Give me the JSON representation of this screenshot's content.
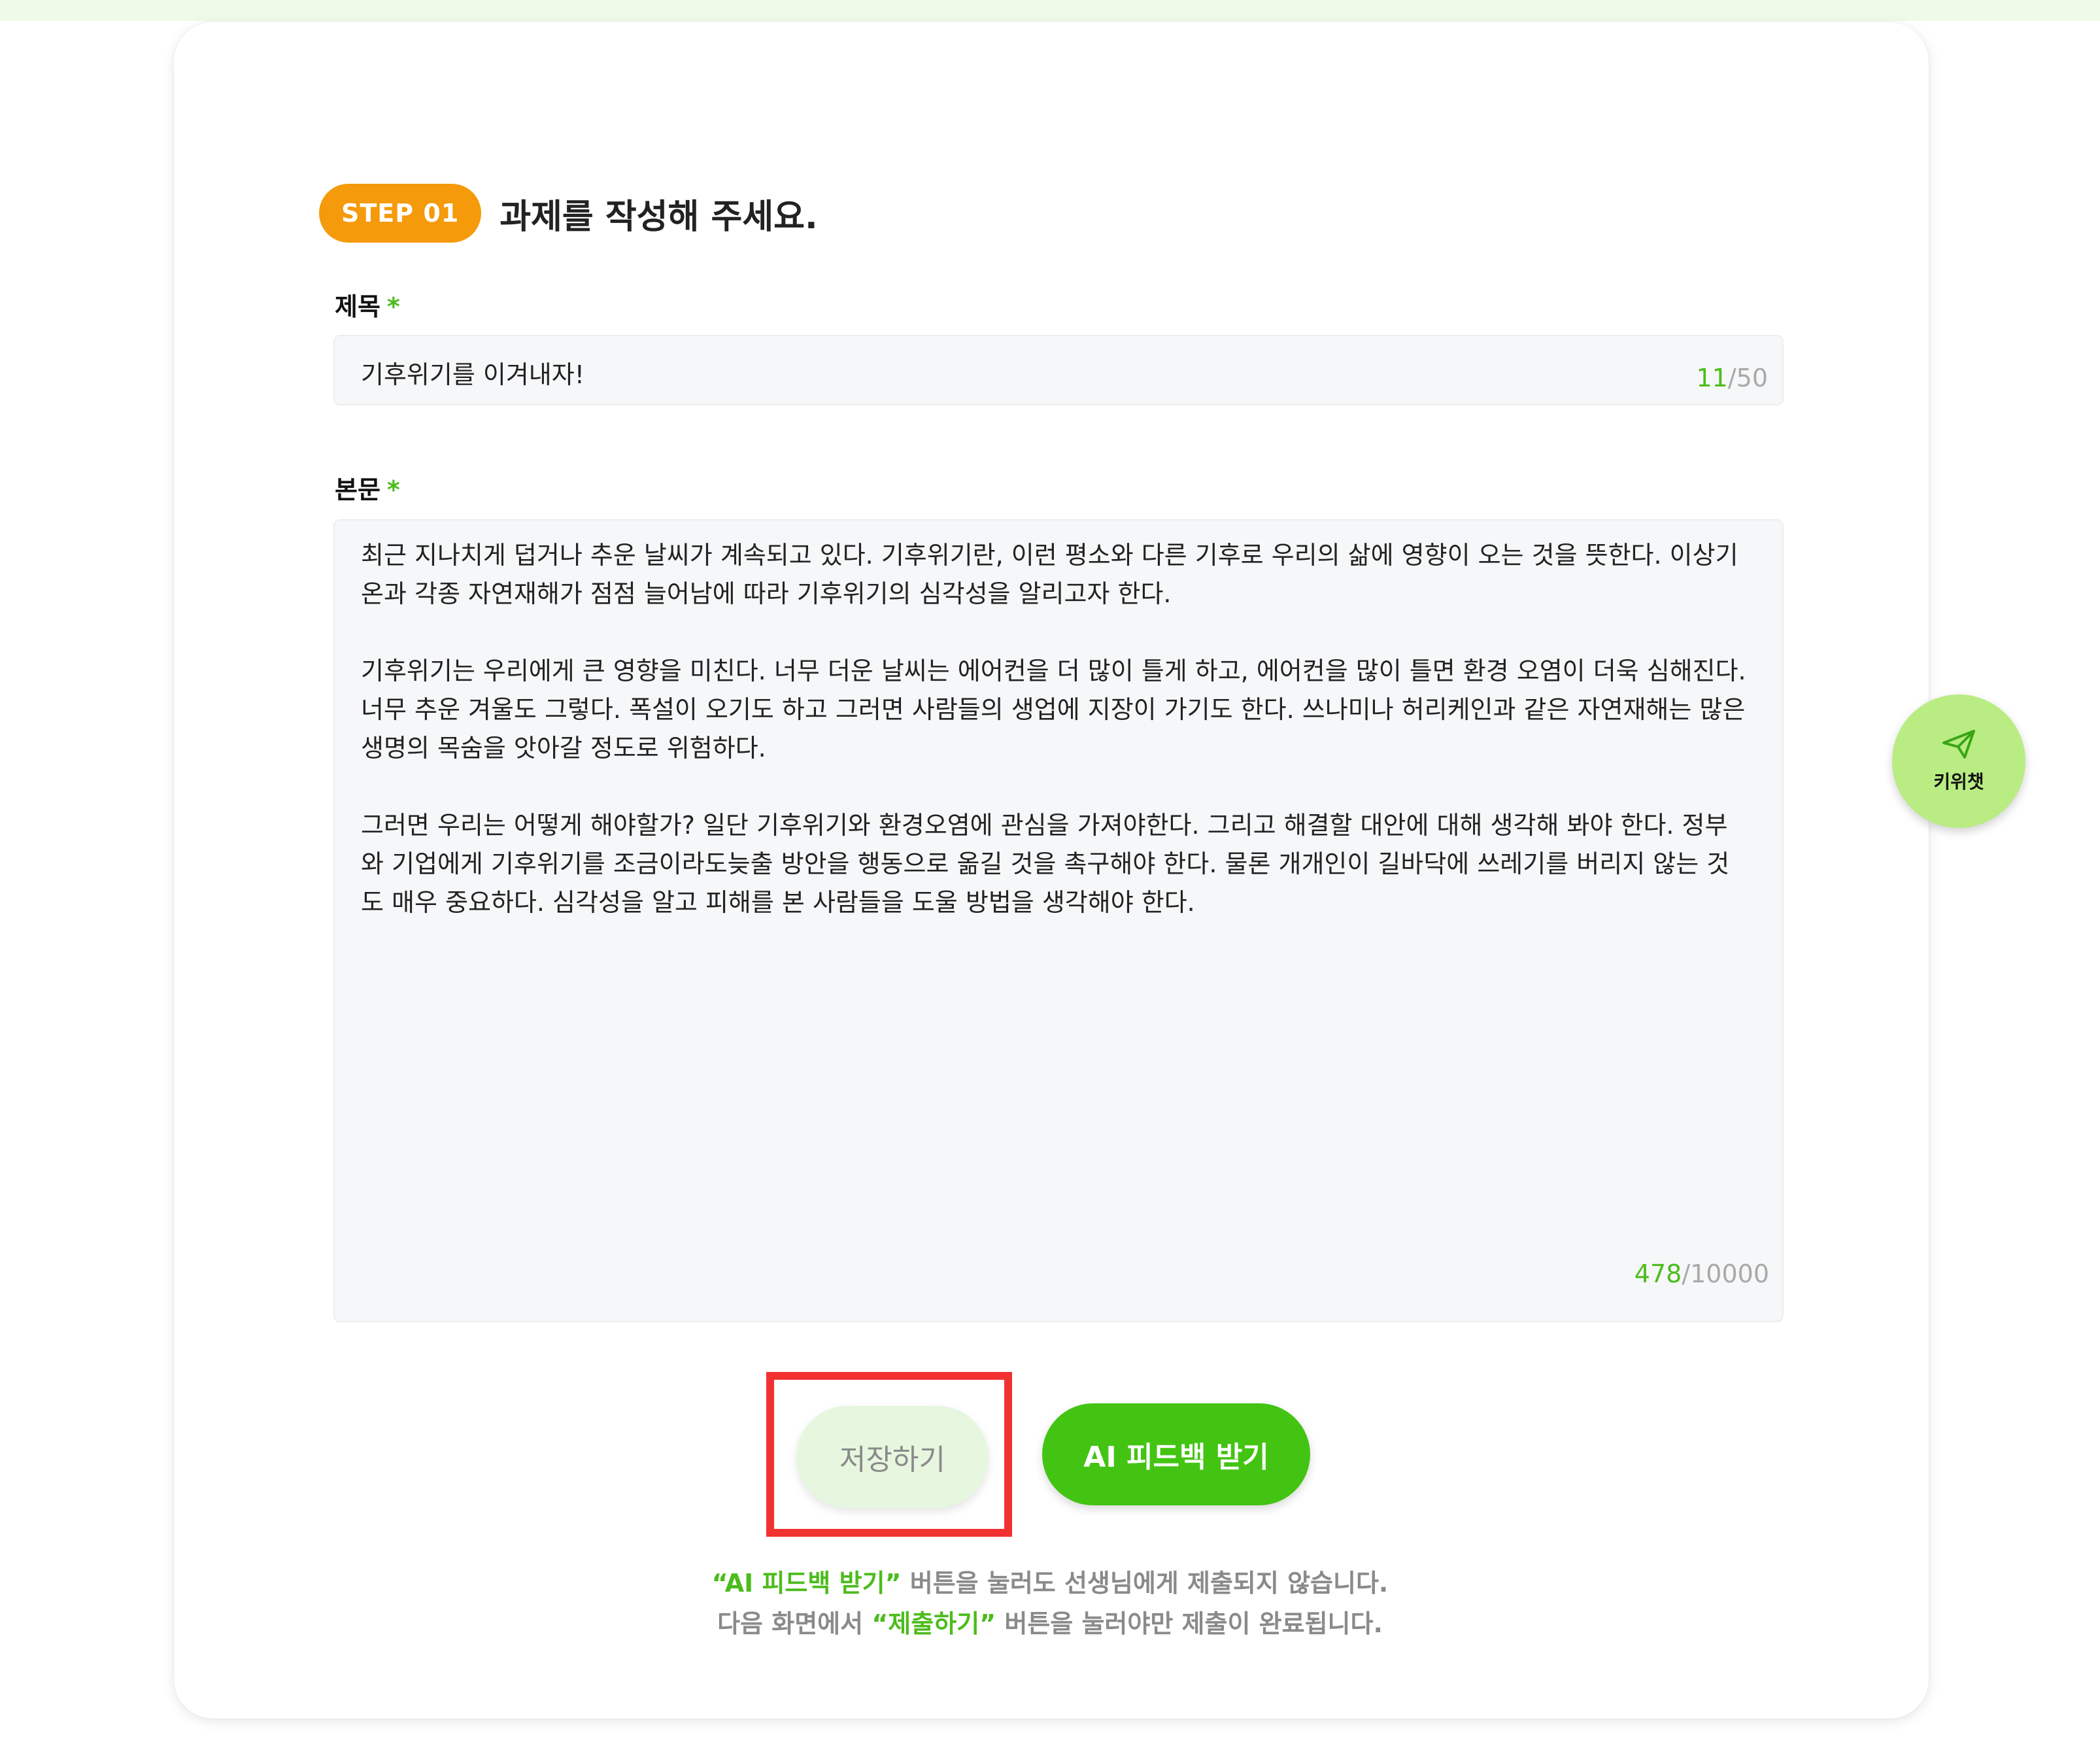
{
  "step": {
    "badge": "STEP 01",
    "title": "과제를 작성해 주세요."
  },
  "title_field": {
    "label": "제목",
    "required_mark": "*",
    "value": "기후위기를 이겨내자!",
    "count_current": "11",
    "count_sep_max": "/50"
  },
  "body_field": {
    "label": "본문",
    "required_mark": "*",
    "paragraphs": [
      "최근 지나치게 덥거나 추운 날씨가 계속되고 있다. 기후위기란, 이런 평소와 다른 기후로 우리의 삶에 영향이 오는 것을 뜻한다. 이상기온과 각종 자연재해가 점점 늘어남에 따라 기후위기의 심각성을 알리고자 한다.",
      "기후위기는 우리에게 큰 영향을 미친다. 너무 더운 날씨는 에어컨을 더 많이 틀게 하고, 에어컨을 많이 틀면 환경 오염이 더욱 심해진다. 너무 추운 겨울도 그렇다. 폭설이 오기도 하고 그러면 사람들의 생업에 지장이 가기도 한다. 쓰나미나 허리케인과 같은 자연재해는 많은 생명의 목숨을 앗아갈 정도로 위험하다.",
      "그러면 우리는 어떻게 해야할가? 일단 기후위기와 환경오염에 관심을 가져야한다. 그리고 해결할 대안에 대해 생각해 봐야 한다. 정부와 기업에게 기후위기를 조금이라도늦출 방안을 행동으로 옮길 것을 촉구해야 한다. 물론 개개인이 길바닥에 쓰레기를 버리지 않는 것도 매우 중요하다. 심각성을 알고 피해를 본 사람들을 도울 방법을 생각해야 한다."
    ],
    "count_current": "478",
    "count_sep_max": "/10000"
  },
  "chat_fab": {
    "label": "키위챗",
    "icon": "send-icon"
  },
  "buttons": {
    "save": "저장하기",
    "ai_feedback": "AI 피드백 받기"
  },
  "notice": {
    "line1_highlight": "“AI 피드백 받기”",
    "line1_rest": " 버튼을 눌러도 선생님에게 제출되지 않습니다.",
    "line2_pre": "다음 화면에서 ",
    "line2_highlight": "“제출하기”",
    "line2_rest": " 버튼을 눌러야만 제출이 완료됩니다."
  },
  "colors": {
    "accent_green": "#43c413",
    "step_orange": "#f59a0a",
    "highlight_red": "#f23131"
  }
}
